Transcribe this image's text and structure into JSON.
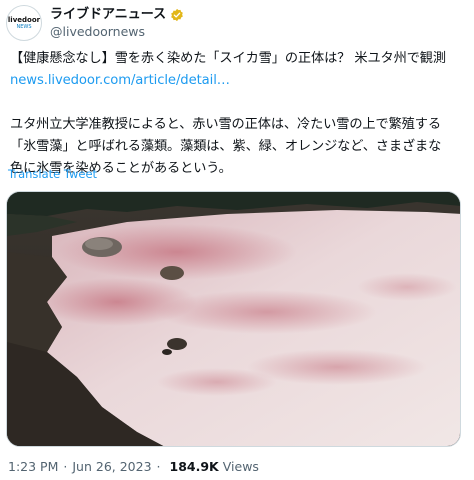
{
  "account": {
    "display_name": "ライブドアニュース",
    "handle": "@livedoornews",
    "avatar_line1": "livedoor",
    "avatar_line2": "NEWS",
    "verified_color": "#e2b719"
  },
  "tweet": {
    "line1": "【健康懸念なし】雪を赤く染めた「スイカ雪」の正体は？ 米ユタ州で観測",
    "link": "news.livedoor.com/article/detail…",
    "line3": "ユタ州立大学准教授によると、赤い雪の正体は、冷たい雪の上で繁殖する",
    "line4": "「氷雪藻」と呼ばれる藻類。藻類は、紫、緑、オレンジなど、さまざまな",
    "line5": "色に氷雪を染めることがあるという。"
  },
  "translate_label": "Translate Tweet",
  "meta": {
    "time": "1:23 PM",
    "date": "Jun 26, 2023",
    "views_count": "184.9K",
    "views_label": "Views",
    "separator": "·"
  },
  "colors": {
    "link": "#1d9bf0",
    "secondary_text": "#536471",
    "snow": "#e9dada",
    "red_algae": "#c77e88"
  }
}
